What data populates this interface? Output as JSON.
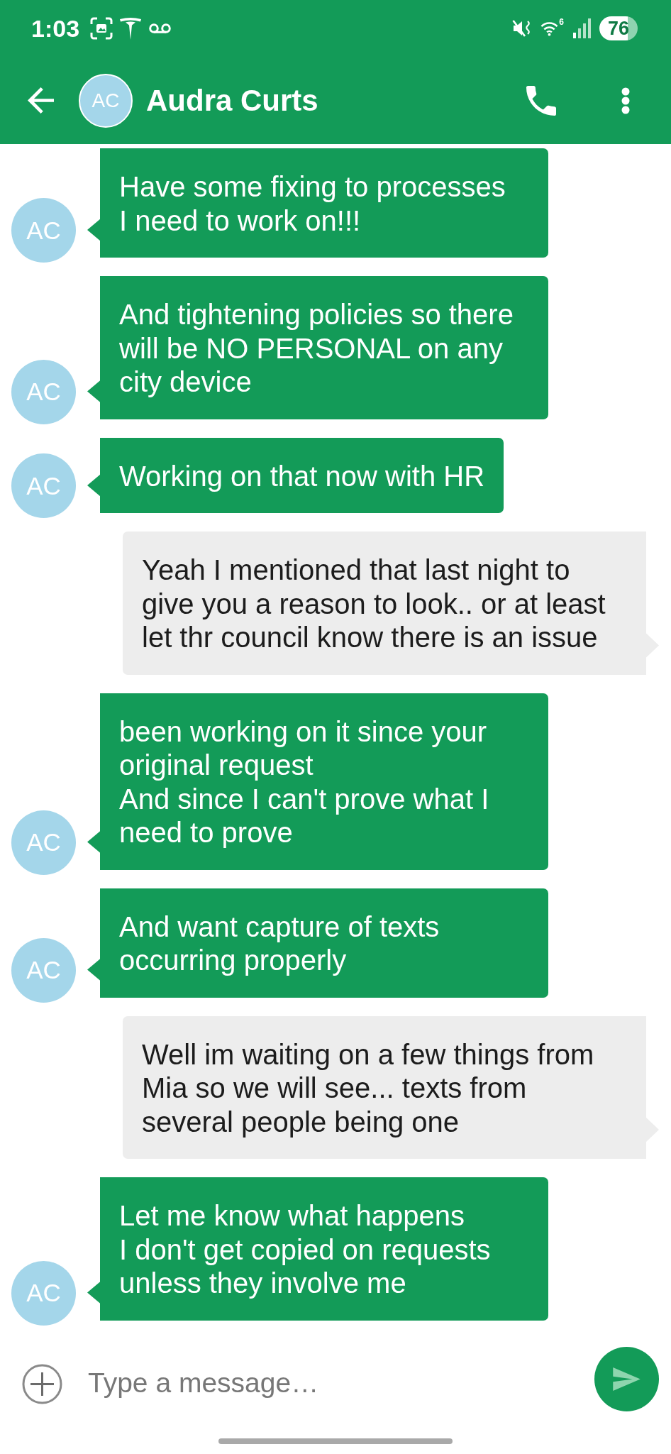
{
  "status_bar": {
    "time": "1:03",
    "wifi_badge": "6",
    "battery": "76"
  },
  "header": {
    "avatar": "AC",
    "title": "Audra Curts"
  },
  "messages": [
    {
      "kind": "received",
      "avatar": "AC",
      "text": "Have some fixing to processes\nI need to work on!!!"
    },
    {
      "kind": "received",
      "avatar": "AC",
      "text": "And tightening policies so there\nwill be NO PERSONAL on any\ncity device"
    },
    {
      "kind": "received",
      "avatar": "AC",
      "text": "Working on that now with HR"
    },
    {
      "kind": "sent",
      "text": "Yeah I mentioned that last night to\ngive you a reason to look.. or at least\nlet thr council know there is an issue"
    },
    {
      "kind": "received",
      "avatar": "AC",
      "text": "been working on it since your\noriginal request\nAnd since I can't prove what I\nneed to prove"
    },
    {
      "kind": "received",
      "avatar": "AC",
      "text": "And want capture of texts\noccurring properly"
    },
    {
      "kind": "sent",
      "text": "Well im waiting on a few things from\nMia so we will see... texts from\nseveral people being one"
    },
    {
      "kind": "received",
      "avatar": "AC",
      "text": "Let me know what happens\nI don't get copied on requests\nunless they involve me"
    }
  ],
  "composer": {
    "placeholder": "Type a message…"
  }
}
